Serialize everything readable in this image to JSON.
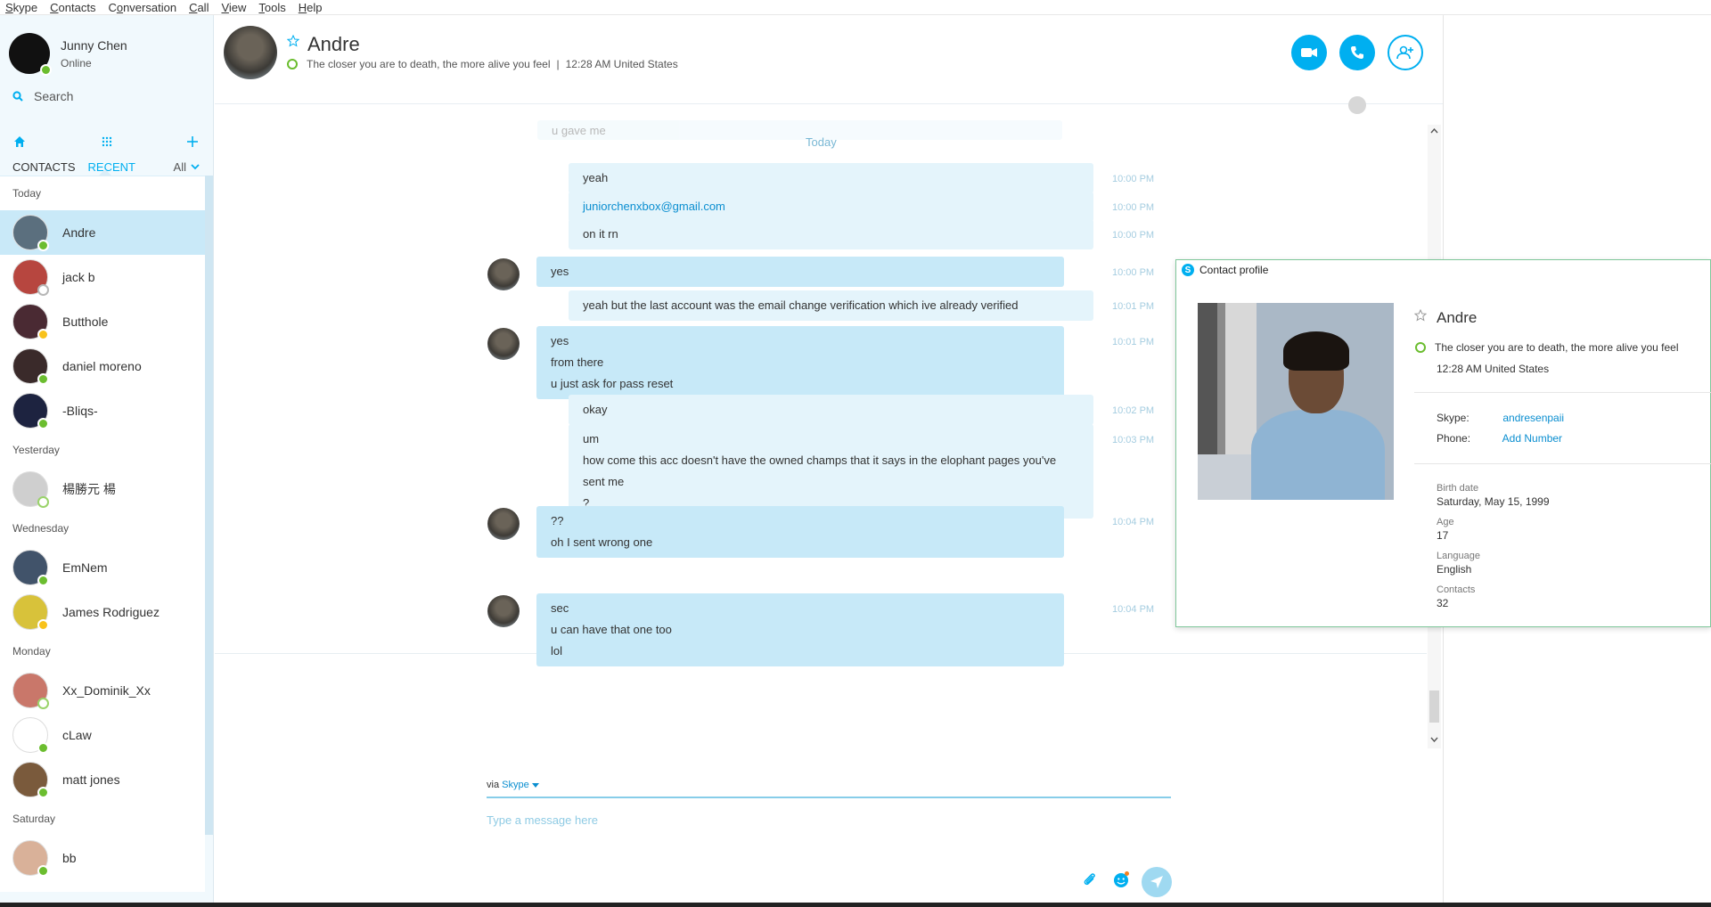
{
  "menu": [
    {
      "pre": "",
      "u": "S",
      "post": "kype"
    },
    {
      "pre": "",
      "u": "C",
      "post": "ontacts"
    },
    {
      "pre": "C",
      "u": "o",
      "post": "nversation"
    },
    {
      "pre": "",
      "u": "C",
      "post": "all"
    },
    {
      "pre": "",
      "u": "V",
      "post": "iew"
    },
    {
      "pre": "",
      "u": "T",
      "post": "ools"
    },
    {
      "pre": "",
      "u": "H",
      "post": "elp"
    }
  ],
  "me": {
    "name": "Junny Chen",
    "status": "Online"
  },
  "search": {
    "placeholder": "Search"
  },
  "tabs": {
    "contacts": "CONTACTS",
    "recent": "RECENT",
    "filter": "All"
  },
  "recent_groups": [
    {
      "label": "Today",
      "contacts": [
        {
          "name": "Andre",
          "selected": true,
          "presence": "online",
          "color": "#5b6f7e"
        },
        {
          "name": "jack b",
          "selected": false,
          "presence": "grey",
          "color": "#b7463f"
        },
        {
          "name": "Butthole",
          "selected": false,
          "presence": "away",
          "color": "#4a2a33"
        },
        {
          "name": "daniel moreno",
          "selected": false,
          "presence": "online",
          "color": "#3a2a2a"
        },
        {
          "name": "-Bliqs-",
          "selected": false,
          "presence": "online",
          "color": "#1d2340"
        }
      ]
    },
    {
      "label": "Yesterday",
      "contacts": [
        {
          "name": "楊勝元 楊",
          "selected": false,
          "presence": "off",
          "color": "#cfcfcf"
        }
      ]
    },
    {
      "label": "Wednesday",
      "contacts": [
        {
          "name": "EmNem",
          "selected": false,
          "presence": "online",
          "color": "#41536a"
        },
        {
          "name": "James Rodriguez",
          "selected": false,
          "presence": "away",
          "color": "#d8c23a"
        }
      ]
    },
    {
      "label": "Monday",
      "contacts": [
        {
          "name": "Xx_Dominik_Xx",
          "selected": false,
          "presence": "off",
          "color": "#c9776a"
        },
        {
          "name": "cLaw",
          "selected": false,
          "presence": "online",
          "color": "#ffffff"
        },
        {
          "name": "matt jones",
          "selected": false,
          "presence": "online",
          "color": "#7a5a3c"
        }
      ]
    },
    {
      "label": "Saturday",
      "contacts": [
        {
          "name": "bb",
          "selected": false,
          "presence": "online",
          "color": "#d9b199"
        }
      ]
    }
  ],
  "header": {
    "name": "Andre",
    "mood": "The closer you are to death, the more alive you feel",
    "local_time": "12:28 AM United States"
  },
  "conversation": {
    "faded_text": "u gave me",
    "separator_top": "Today",
    "separator_mid": "Today",
    "messages": [
      {
        "from": "me",
        "lines": [
          "yeah"
        ],
        "time": "10:00 PM"
      },
      {
        "from": "me",
        "lines": [
          "juniorchenxbox@gmail.com"
        ],
        "time": "10:00 PM",
        "link": true
      },
      {
        "from": "me",
        "lines": [
          "on it rn"
        ],
        "time": "10:00 PM"
      },
      {
        "from": "them",
        "lines": [
          "yes"
        ],
        "time": "10:00 PM"
      },
      {
        "from": "me",
        "lines": [
          "yeah but the last account was the email change verification which ive already verified"
        ],
        "time": "10:01 PM"
      },
      {
        "from": "them",
        "lines": [
          "yes",
          "from there",
          "u just ask for pass reset"
        ],
        "time": "10:01 PM"
      },
      {
        "from": "me",
        "lines": [
          "okay"
        ],
        "time": "10:02 PM"
      },
      {
        "from": "me",
        "lines": [
          "um",
          "how come this acc doesn't have the owned champs that it says in the elophant pages you've",
          "sent me",
          "?"
        ],
        "time": "10:03 PM"
      },
      {
        "from": "them",
        "lines": [
          "??",
          "oh I sent wrong one"
        ],
        "time": "10:04 PM"
      },
      {
        "from": "them",
        "lines": [
          "sec",
          "u can have that one too",
          "lol"
        ],
        "time": "10:04 PM"
      }
    ]
  },
  "composer": {
    "via_label": "via",
    "via_service": "Skype",
    "placeholder": "Type a message here"
  },
  "profile": {
    "title": "Contact profile",
    "name": "Andre",
    "mood": "The closer you are to death, the more alive you feel",
    "local_time": "12:28 AM United States",
    "skype_label": "Skype:",
    "skype_value": "andresenpaii",
    "phone_label": "Phone:",
    "phone_value": "Add Number",
    "birth_label": "Birth date",
    "birth_value": "Saturday, May 15, 1999",
    "age_label": "Age",
    "age_value": "17",
    "language_label": "Language",
    "language_value": "English",
    "contacts_label": "Contacts",
    "contacts_value": "32"
  },
  "colors": {
    "accent": "#00aff0",
    "online": "#6bbd2f",
    "away": "#f8c21b",
    "bubble_them": "#c7e9f8",
    "bubble_me": "#e4f4fb"
  }
}
